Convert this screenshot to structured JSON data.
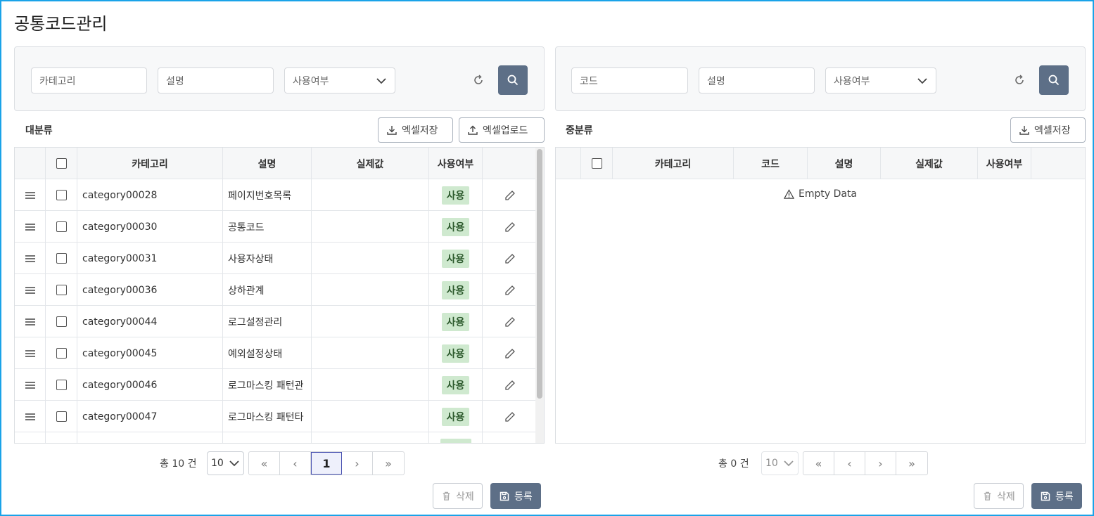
{
  "page_title": "공통코드관리",
  "left": {
    "search": {
      "category_placeholder": "카테고리",
      "desc_placeholder": "설명",
      "use_select": "사용여부"
    },
    "section_label": "대분류",
    "excel_save": "엑셀저장",
    "excel_upload": "엑셀업로드",
    "columns": [
      "카테고리",
      "설명",
      "실제값",
      "사용여부"
    ],
    "rows": [
      {
        "category": "category00028",
        "desc": "페이지번호목록",
        "value": "",
        "use": "사용"
      },
      {
        "category": "category00030",
        "desc": "공통코드",
        "value": "",
        "use": "사용"
      },
      {
        "category": "category00031",
        "desc": "사용자상태",
        "value": "",
        "use": "사용"
      },
      {
        "category": "category00036",
        "desc": "상하관계",
        "value": "",
        "use": "사용"
      },
      {
        "category": "category00044",
        "desc": "로그설정관리",
        "value": "",
        "use": "사용"
      },
      {
        "category": "category00045",
        "desc": "예외설정상태",
        "value": "",
        "use": "사용"
      },
      {
        "category": "category00046",
        "desc": "로그마스킹 패턴관",
        "value": "",
        "use": "사용"
      },
      {
        "category": "category00047",
        "desc": "로그마스킹 패턴타",
        "value": "",
        "use": "사용"
      }
    ],
    "total_text": "총 10 건",
    "page_size": "10",
    "current_page": "1",
    "delete_label": "삭제",
    "register_label": "등록"
  },
  "right": {
    "search": {
      "code_placeholder": "코드",
      "desc_placeholder": "설명",
      "use_select": "사용여부"
    },
    "section_label": "중분류",
    "excel_save": "엑셀저장",
    "columns": [
      "카테고리",
      "코드",
      "설명",
      "실제값",
      "사용여부"
    ],
    "empty_text": "Empty  Data",
    "total_text": "총 0 건",
    "page_size": "10",
    "delete_label": "삭제",
    "register_label": "등록"
  },
  "colors": {
    "primary": "#5d6f87",
    "badge_bg": "#cfe9cf",
    "frame": "#1aa3e8",
    "active_page": "#4750b0"
  },
  "icons": {
    "drag": "drag-handle-icon",
    "edit": "pencil-icon",
    "refresh": "refresh-icon",
    "search": "search-icon",
    "download": "download-icon",
    "upload": "upload-icon",
    "trash": "trash-icon",
    "save": "floppy-icon",
    "warning": "warning-icon"
  }
}
